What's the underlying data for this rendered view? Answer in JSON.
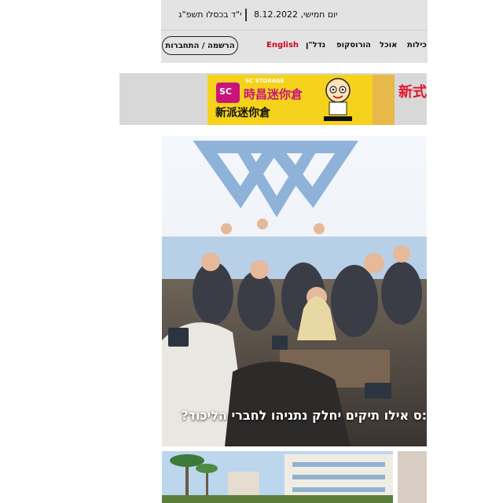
{
  "header": {
    "hebrew_date": "י\"ד בכסלו תשפ\"ג",
    "gregorian_date": "יום חמישי, 8.12.2022",
    "signup_label": "הרשמה / התחברות",
    "nav": {
      "english": "English",
      "real_estate": "נדל\"ן",
      "horoscope": "הורוסקופ",
      "food": "אוכל",
      "news": "כילות"
    },
    "background_color": "#e3e3e3",
    "english_color": "#d0021b"
  },
  "ad": {
    "brand_en": "SC STORAGE",
    "brand_zh": "時昌迷你倉",
    "slogan": "新派迷你倉",
    "new_label": "新式",
    "logo_letters": "SC",
    "accent_color": "#f5d21b",
    "brand_color": "#c8147a"
  },
  "hero": {
    "headline": ":ס אילו תיקים יחלק נתניהו לחברי הליכוד?"
  },
  "icons": {
    "mascot": "cartoon-mascot-icon",
    "flag_star": "star-of-david-icon"
  }
}
